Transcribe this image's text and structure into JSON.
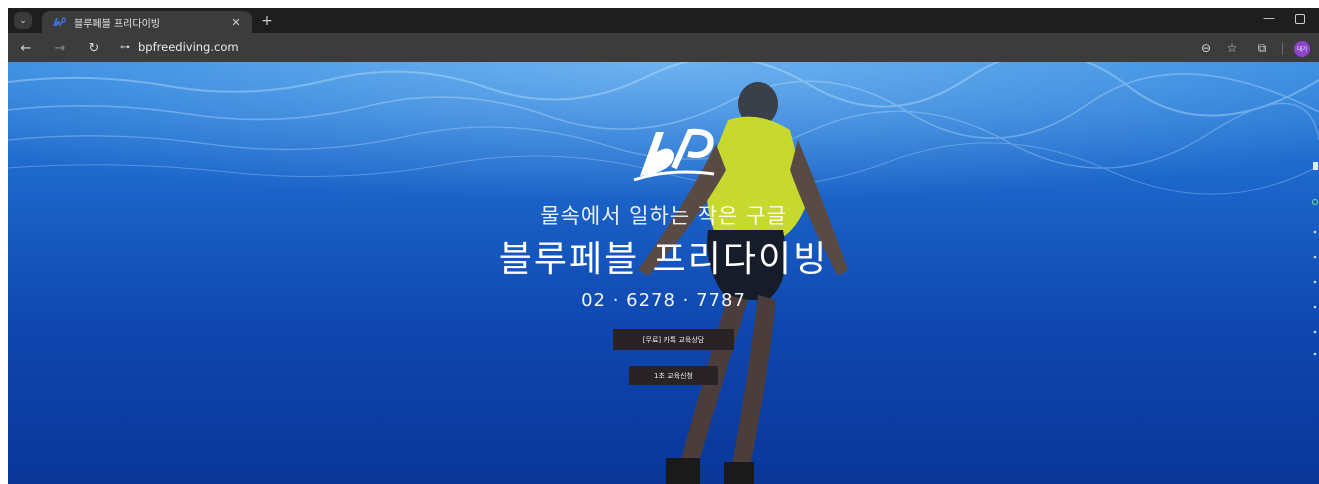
{
  "browser": {
    "tab": {
      "title": "블루페블 프리다이빙",
      "close_glyph": "✕",
      "favicon": "bp-logo-icon"
    },
    "new_tab_glyph": "+",
    "window": {
      "minimize_glyph": "—"
    },
    "toolbar": {
      "back_glyph": "←",
      "forward_glyph": "→",
      "reload_glyph": "↻",
      "site_info_glyph": "⊶",
      "url": "bpfreediving.com",
      "zoom_glyph": "⊖",
      "bookmark_glyph": "☆",
      "extensions_glyph": "⧉",
      "profile_label": "대기"
    }
  },
  "hero": {
    "subtitle": "물속에서 일하는 작은 구글",
    "title": "블루페블 프리다이빙",
    "phone": "02 · 6278 · 7787",
    "buttons": {
      "kakao": "[무료] 카톡 교육상담",
      "apply": "1초 교육신청"
    }
  },
  "colors": {
    "water_top": "#2f86de",
    "water_bottom": "#0a3698",
    "button_bg": "#2a2326",
    "profile": "#8e44c9"
  }
}
